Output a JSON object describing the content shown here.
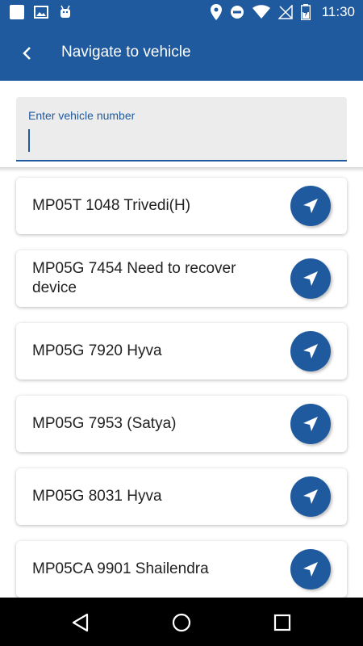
{
  "status_bar": {
    "time": "11:30",
    "icons": [
      "square-notification-icon",
      "image-notification-icon",
      "android-notification-icon",
      "location-icon",
      "do-not-disturb-icon",
      "wifi-icon",
      "no-signal-icon",
      "battery-charging-icon"
    ]
  },
  "app_bar": {
    "title": "Navigate to vehicle",
    "back_icon": "back-arrow-icon"
  },
  "search": {
    "label": "Enter vehicle number",
    "value": ""
  },
  "vehicles": [
    {
      "name": "MP05T 1048 Trivedi(H)"
    },
    {
      "name": "MP05G 7454 Need to recover device"
    },
    {
      "name": "MP05G 7920 Hyva"
    },
    {
      "name": "MP05G 7953 (Satya)"
    },
    {
      "name": "MP05G 8031 Hyva"
    },
    {
      "name": "MP05CA 9901 Shailendra"
    }
  ],
  "navigation_bar": {
    "keys": [
      "back-triangle-icon",
      "home-circle-icon",
      "recents-square-icon"
    ]
  },
  "colors": {
    "primary": "#1F5A9E",
    "search_bg": "#ECECEC"
  }
}
